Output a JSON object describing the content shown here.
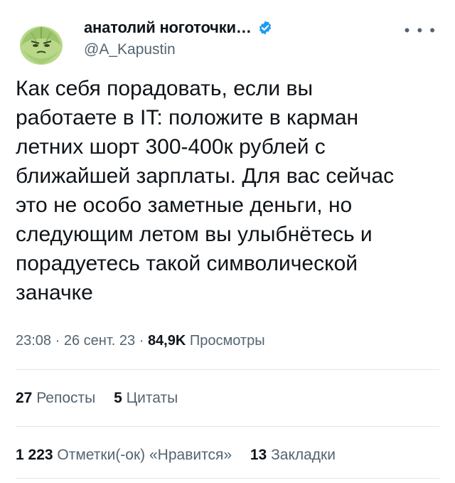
{
  "author": {
    "display_name": "анатолий ноготочки…",
    "handle": "@A_Kapustin",
    "avatar_icon": "cabbage-avatar-icon",
    "verified_icon": "verified-badge-icon",
    "more_icon": "more-options-icon"
  },
  "tweet": {
    "text": "Как себя порадовать, если вы\nработаете в IT: положите в карман\nлетних шорт 300-400к рублей с\nближайшей зарплаты. Для вас сейчас\nэто не особо заметные деньги, но\nследующим летом вы улыбнётесь и\nпорадуетесь такой символической\nзаначке"
  },
  "meta": {
    "time": "23:08",
    "date": "26 сент. 23",
    "separator": "·",
    "views_count": "84,9K",
    "views_label": "Просмотры"
  },
  "stats": {
    "reposts_count": "27",
    "reposts_label": "Репосты",
    "quotes_count": "5",
    "quotes_label": "Цитаты",
    "likes_count": "1 223",
    "likes_label": "Отметки(-ок) «Нравится»",
    "bookmarks_count": "13",
    "bookmarks_label": "Закладки"
  },
  "colors": {
    "text": "#0f1419",
    "secondary": "#536471",
    "verified": "#1d9bf0",
    "divider": "#e1e6ea"
  }
}
